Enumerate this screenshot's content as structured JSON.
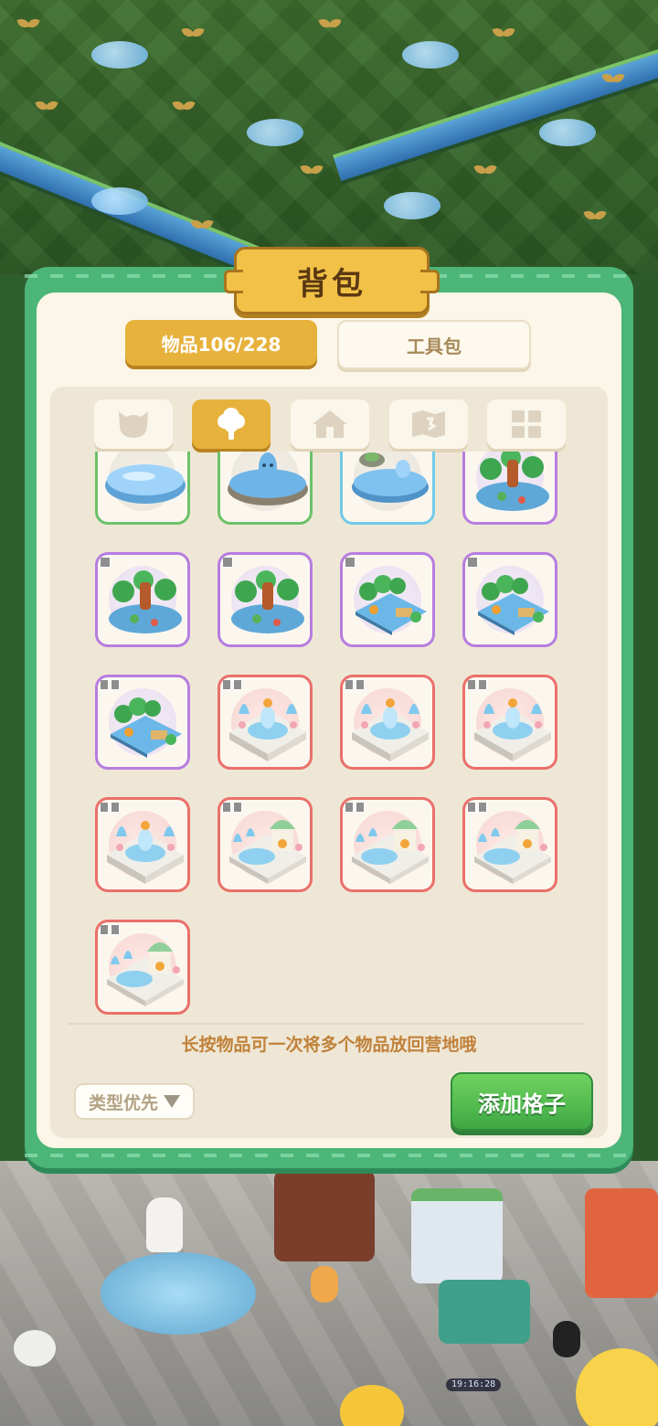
{
  "panel": {
    "title": "背包",
    "tabs": [
      {
        "label": "物品106/228",
        "active": true
      },
      {
        "label": "工具包",
        "active": false
      }
    ],
    "categories": [
      {
        "icon": "cat-head-icon",
        "active": false
      },
      {
        "icon": "tree-icon",
        "active": true
      },
      {
        "icon": "house-icon",
        "active": false
      },
      {
        "icon": "map-icon",
        "active": false
      },
      {
        "icon": "grid-icon",
        "active": false
      }
    ],
    "hint": "长按物品可一次将多个物品放回营地哦",
    "sort_label": "类型优先",
    "add_button": "添加格子"
  },
  "items": [
    {
      "kind": "pond-plain",
      "rarity": "green",
      "size": ""
    },
    {
      "kind": "pond-bunny",
      "rarity": "green",
      "size": ""
    },
    {
      "kind": "pond-rock-bunny",
      "rarity": "cyan",
      "size": ""
    },
    {
      "kind": "forest-pond-tower",
      "rarity": "purple",
      "size": ""
    },
    {
      "kind": "forest-pond-tower",
      "rarity": "purple",
      "size": "1"
    },
    {
      "kind": "forest-pond-tower",
      "rarity": "purple",
      "size": "1"
    },
    {
      "kind": "forest-stream",
      "rarity": "purple",
      "size": "1"
    },
    {
      "kind": "forest-stream",
      "rarity": "purple",
      "size": "1"
    },
    {
      "kind": "forest-stream",
      "rarity": "purple",
      "size": "2"
    },
    {
      "kind": "fountain-plaza",
      "rarity": "red",
      "size": "2"
    },
    {
      "kind": "fountain-plaza",
      "rarity": "red",
      "size": "2"
    },
    {
      "kind": "fountain-plaza",
      "rarity": "red",
      "size": "2"
    },
    {
      "kind": "fountain-plaza",
      "rarity": "red",
      "size": "2"
    },
    {
      "kind": "gazebo-plaza",
      "rarity": "red",
      "size": "2"
    },
    {
      "kind": "gazebo-plaza",
      "rarity": "red",
      "size": "2"
    },
    {
      "kind": "gazebo-plaza",
      "rarity": "red",
      "size": "2"
    },
    {
      "kind": "gazebo-plaza",
      "rarity": "red",
      "size": "2"
    }
  ],
  "clock": "19:16:28",
  "colors": {
    "panel_green": "#4cb578",
    "tab_gold": "#e7b23c",
    "rarity_green": "#6cc26a",
    "rarity_cyan": "#72c9e6",
    "rarity_purple": "#b77de0",
    "rarity_red": "#ea706a",
    "add_green": "#3fa844",
    "hint_text": "#c0823a"
  }
}
